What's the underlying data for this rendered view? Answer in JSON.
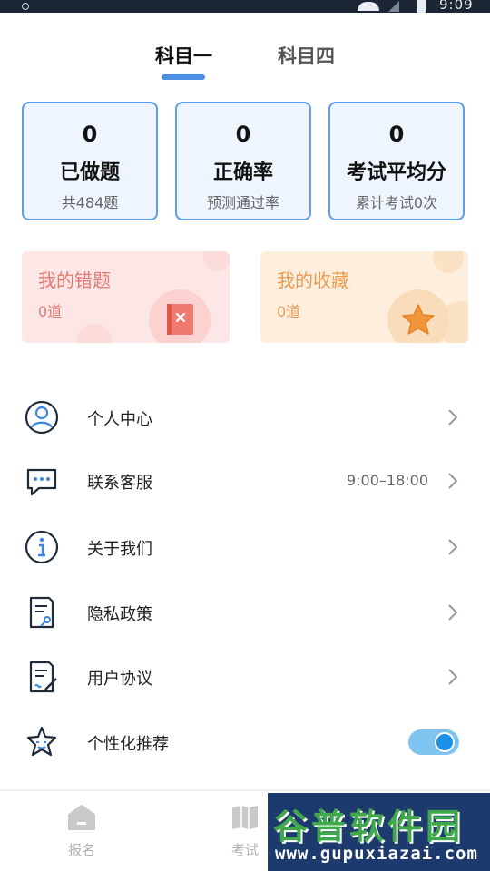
{
  "status_bar": {
    "time": "9:09"
  },
  "tabs": [
    {
      "label": "科目一",
      "active": true
    },
    {
      "label": "科目四",
      "active": false
    }
  ],
  "stats": [
    {
      "value": "0",
      "label": "已做题",
      "sub": "共484题"
    },
    {
      "value": "0",
      "label": "正确率",
      "sub": "预测通过率"
    },
    {
      "value": "0",
      "label": "考试平均分",
      "sub": "累计考试0次"
    }
  ],
  "cards": {
    "wrong": {
      "title": "我的错题",
      "count": "0道",
      "icon": "notebook-x-icon"
    },
    "favorite": {
      "title": "我的收藏",
      "count": "0道",
      "icon": "star-icon"
    }
  },
  "menu": [
    {
      "label": "个人中心",
      "value": "",
      "icon": "user-circle-icon"
    },
    {
      "label": "联系客服",
      "value": "9:00–18:00",
      "icon": "chat-bubble-icon"
    },
    {
      "label": "关于我们",
      "value": "",
      "icon": "info-icon"
    },
    {
      "label": "隐私政策",
      "value": "",
      "icon": "privacy-document-icon"
    },
    {
      "label": "用户协议",
      "value": "",
      "icon": "agreement-document-icon"
    },
    {
      "label": "个性化推荐",
      "value": "",
      "icon": "star-face-icon",
      "toggle_on": true
    }
  ],
  "bottom_nav": [
    {
      "label": "报名",
      "icon": "home-icon"
    },
    {
      "label": "考试",
      "icon": "book-icon"
    }
  ],
  "watermark": {
    "title": "谷普软件园",
    "url": "www.gupuxiazai.com"
  },
  "colors": {
    "accent": "#4d8fe3",
    "wrong": "#e67a72",
    "favorite": "#ea9c52",
    "toggle": "#1a91e6"
  }
}
